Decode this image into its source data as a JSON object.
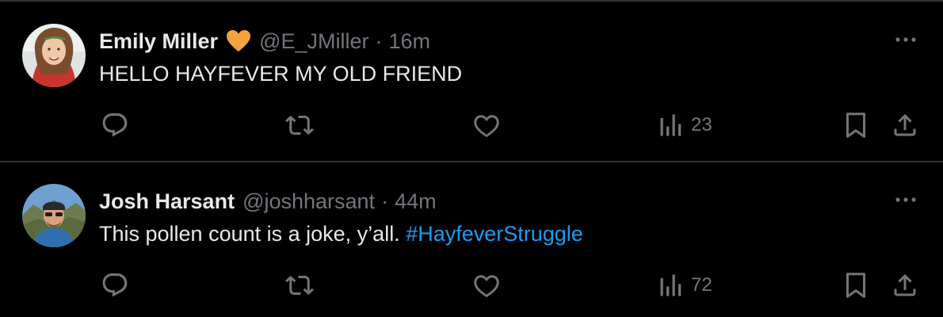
{
  "tweets": [
    {
      "name": "Emily Miller",
      "badge_color": "#f4a23c",
      "handle": "@E_JMiller",
      "separator": "·",
      "time": "16m",
      "text": "HELLO HAYFEVER MY OLD FRIEND",
      "hashtag": "",
      "views": "23"
    },
    {
      "name": "Josh Harsant",
      "handle": "@joshharsant",
      "separator": "·",
      "time": "44m",
      "text": "This pollen count is a joke, y’all. ",
      "hashtag": "#HayfeverStruggle",
      "views": "72"
    }
  ],
  "icons": {
    "reply": "reply-icon",
    "retweet": "retweet-icon",
    "like": "heart-icon",
    "views": "views-icon",
    "bookmark": "bookmark-icon",
    "share": "share-icon",
    "more": "more-icon",
    "verified": "heart-badge-icon"
  },
  "colors": {
    "background": "#000000",
    "text": "#e7e9ea",
    "secondary": "#71767b",
    "link": "#1d9bf0",
    "divider": "#2f3336"
  }
}
